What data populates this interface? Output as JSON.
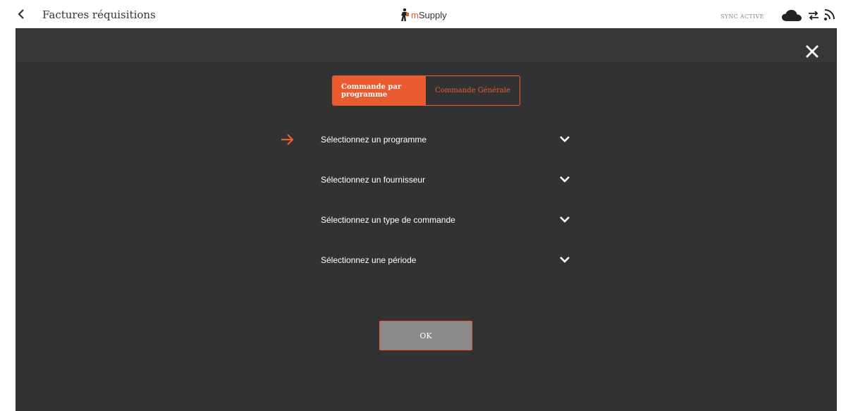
{
  "header": {
    "title": "Factures réquisitions",
    "logo_text": "Supply",
    "logo_prefix": "m",
    "sync_status": "SYNC ACTIVE",
    "icons": {
      "back": "chevron-left-icon",
      "cloud": "cloud-icon",
      "swap": "swap-arrows-icon",
      "feed": "feed-icon"
    }
  },
  "modal": {
    "toggle": {
      "options": [
        {
          "label": "Commande par programme",
          "active": true
        },
        {
          "label": "Commande Générale",
          "active": false
        }
      ]
    },
    "selectors": [
      {
        "label": "Sélectionnez un programme",
        "current": true
      },
      {
        "label": "Sélectionnez un fournisseur",
        "current": false
      },
      {
        "label": "Sélectionnez un type de commande",
        "current": false
      },
      {
        "label": "Sélectionnez une période",
        "current": false
      }
    ],
    "ok_label": "OK",
    "icons": {
      "close": "close-icon",
      "pointer": "arrow-right-icon",
      "dropdown": "chevron-down-icon"
    }
  },
  "colors": {
    "accent": "#e95c30",
    "overlay": "#323232",
    "button_disabled": "#8a8a8a"
  }
}
